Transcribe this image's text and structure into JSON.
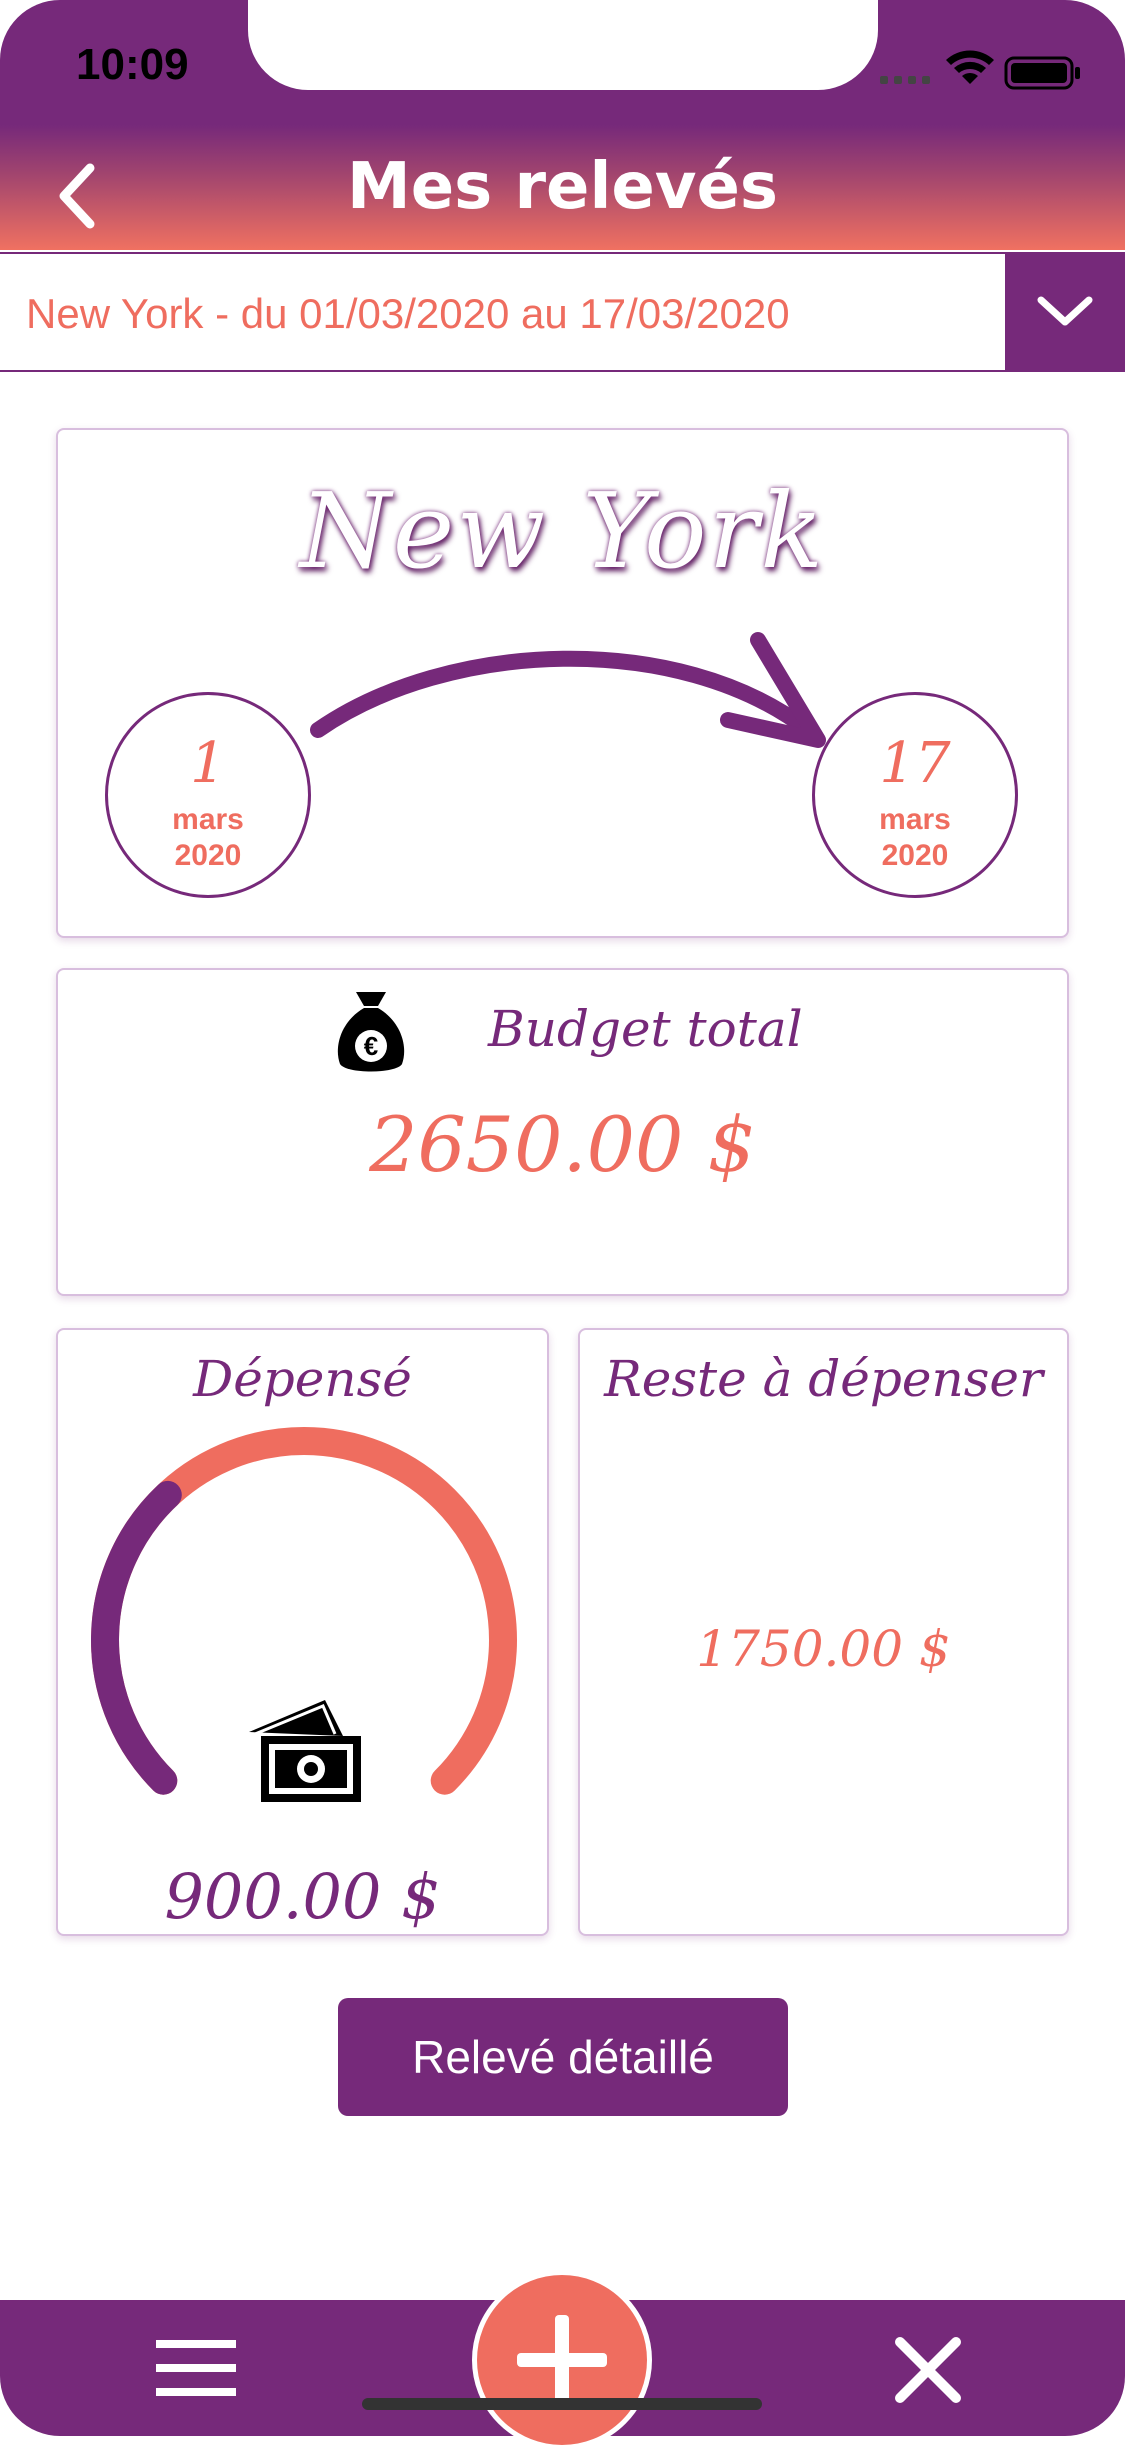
{
  "status_bar": {
    "time": "10:09"
  },
  "header": {
    "title": "Mes relevés",
    "back_icon": "chevron-left-icon"
  },
  "selector": {
    "value": "New York - du 01/03/2020 au 17/03/2020",
    "icon": "chevron-down-icon"
  },
  "trip_card": {
    "city": "New York",
    "start": {
      "day": "1",
      "month": "mars",
      "year": "2020"
    },
    "end": {
      "day": "17",
      "month": "mars",
      "year": "2020"
    }
  },
  "budget_card": {
    "label": "Budget total",
    "value": "2650.00 $",
    "icon": "money-bag-euro-icon"
  },
  "spent_card": {
    "label": "Dépensé",
    "value": "900.00 $",
    "icon": "cash-icon",
    "gauge_fraction": 0.34
  },
  "remaining_card": {
    "label": "Reste à dépenser",
    "value": "1750.00 $"
  },
  "detail_button": {
    "label": "Relevé détaillé"
  },
  "tab_bar": {
    "menu_icon": "menu-icon",
    "add_icon": "plus-icon",
    "close_icon": "close-icon"
  },
  "colors": {
    "primary": "#76297a",
    "accent": "#ef6d5f",
    "white": "#ffffff"
  }
}
